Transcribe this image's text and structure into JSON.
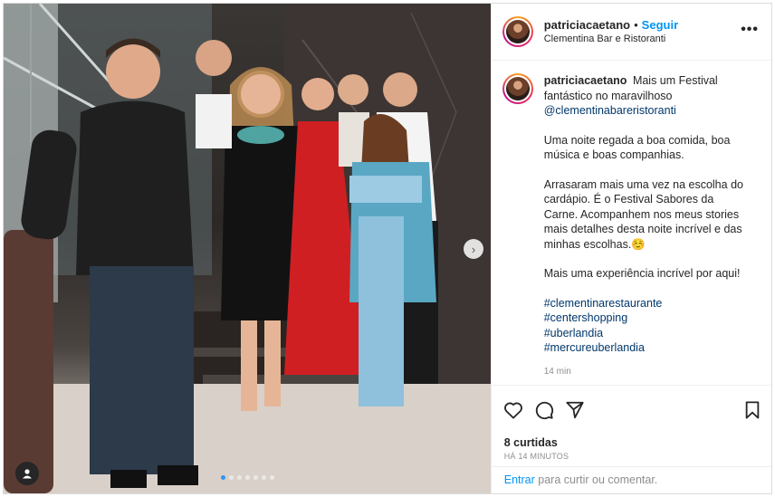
{
  "post": {
    "username": "patriciacaetano",
    "follow_separator": "•",
    "follow_label": "Seguir",
    "location": "Clementina Bar e Ristoranti",
    "more_icon": "more-horizontal-icon",
    "photo_alt_icon": "user-tag-icon",
    "carousel": {
      "count": 7,
      "active": 1
    }
  },
  "caption": {
    "username": "patriciacaetano",
    "line1": "Mais um Festival fantástico no maravilhoso",
    "mention": "@clementinabareristoranti",
    "para2": "Uma noite regada a boa comida, boa música e boas companhias.",
    "para3": "Arrasaram mais uma vez na escolha do cardápio. É o Festival Sabores da Carne. Acompanhem nos meus stories mais detalhes desta noite incrível e das minhas escolhas.☺️",
    "para4": "Mais uma experiência incrível por aqui!",
    "hashtags": [
      "#clementinarestaurante",
      "#centershopping",
      "#uberlandia",
      "#mercureuberlandia"
    ],
    "time": "14 min"
  },
  "actions": {
    "likes": "8 curtidas",
    "ago": "HÁ 14 MINUTOS",
    "login_link": "Entrar",
    "login_rest": " para curtir ou comentar."
  },
  "colors": {
    "accent_blue": "#0095f6",
    "link_navy": "#00376b",
    "muted": "#8e8e8e",
    "border": "#dbdbdb"
  }
}
